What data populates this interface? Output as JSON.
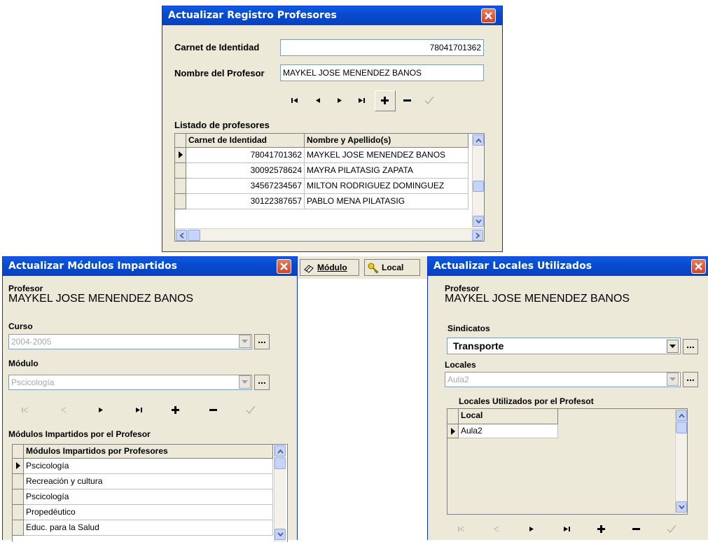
{
  "registro": {
    "title": "Actualizar Registro Profesores",
    "carnet_label": "Carnet de Identidad",
    "carnet_value": "78041701362",
    "nombre_label": "Nombre del Profesor",
    "nombre_value": "MAYKEL JOSE MENENDEZ BANOS",
    "listado_label": "Listado de profesores",
    "columns": [
      "Carnet de Identidad",
      "Nombre y Apellido(s)"
    ],
    "rows": [
      [
        "78041701362",
        "MAYKEL JOSE MENENDEZ BANOS"
      ],
      [
        "30092578624",
        "MAYRA PILATASIG ZAPATA"
      ],
      [
        "34567234567",
        "MILTON RODRIGUEZ DOMINGUEZ"
      ],
      [
        "30122387657",
        "PABLO MENA PILATASIG"
      ]
    ]
  },
  "toolbar": {
    "modulo_label": "Módulo",
    "local_label": "Local"
  },
  "modulos": {
    "title": "Actualizar Módulos Impartidos",
    "profesor_label": "Profesor",
    "profesor_name": "MAYKEL JOSE MENENDEZ BANOS",
    "curso_label": "Curso",
    "curso_value": "2004-2005",
    "modulo_label": "Módulo",
    "modulo_value": "Pscicología",
    "dots": "...",
    "list_label": "Módulos Impartidos por el Profesor",
    "column": "Módulos Impartidos por Profesores",
    "rows": [
      "Pscicología",
      "Recreación y cultura",
      "Pscicología",
      "Propedéutico",
      "Educ. para la Salud"
    ]
  },
  "locales": {
    "title": "Actualizar Locales Utilizados",
    "profesor_label": "Profesor",
    "profesor_name": "MAYKEL JOSE MENENDEZ BANOS",
    "sindicatos_label": "Sindicatos",
    "sindicatos_value": "Transporte",
    "locales_label": "Locales",
    "locales_value": "Aula2",
    "dots": "...",
    "list_label": "Locales Utilizados por el Profesot",
    "column": "Local",
    "rows": [
      "Aula2"
    ]
  },
  "icons": {
    "close": "close-icon",
    "first": "first-record-icon",
    "prior": "prior-record-icon",
    "next": "next-record-icon",
    "last": "last-record-icon",
    "insert": "insert-icon",
    "delete": "delete-icon",
    "post": "post-icon",
    "modulo": "eraser-icon",
    "local": "key-icon"
  }
}
